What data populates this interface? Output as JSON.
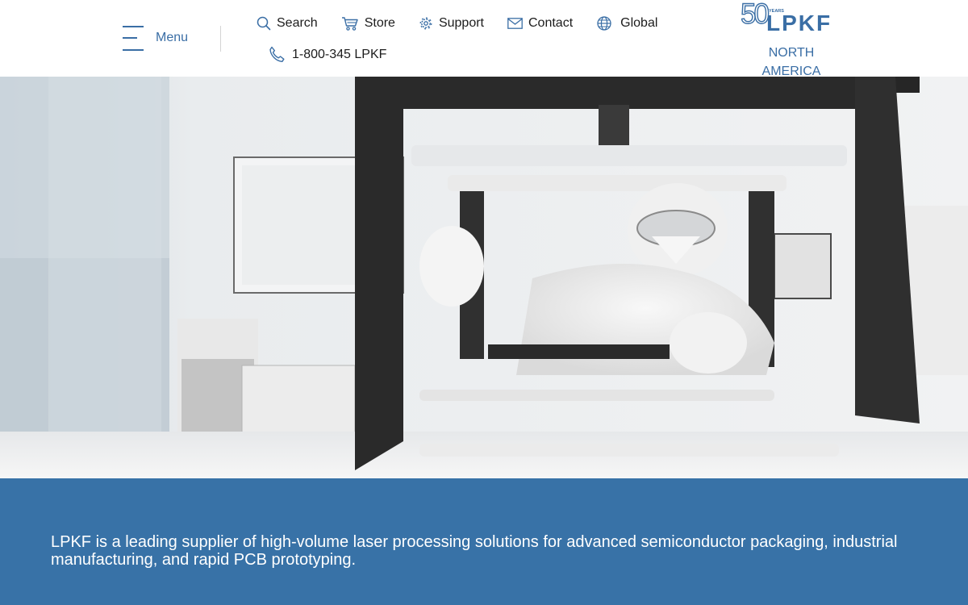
{
  "header": {
    "menu_label": "Menu",
    "nav": [
      {
        "label": "Search",
        "icon": "search-icon"
      },
      {
        "label": "Store",
        "icon": "cart-icon"
      },
      {
        "label": "Support",
        "icon": "support-gear-icon"
      },
      {
        "label": "Contact",
        "icon": "envelope-icon"
      },
      {
        "label": "Global",
        "icon": "globe-icon"
      }
    ],
    "phone": {
      "label": "1-800-345 LPKF",
      "icon": "phone-icon"
    },
    "logo": {
      "text": "LPKF",
      "anniversary": "50",
      "anniversary_label": "YEARS"
    },
    "region_label": "NORTH AMERICA"
  },
  "hero": {
    "image": "clean-room-technician-photo"
  },
  "banner": {
    "tagline": "LPKF is a leading supplier of high-volume laser processing solutions for advanced semiconductor packaging, industrial manufacturing, and rapid PCB prototyping."
  },
  "colors": {
    "brand_blue": "#3a6ea5",
    "banner_blue": "#3872a7",
    "text_dark": "#1c1c1c",
    "white": "#ffffff"
  }
}
